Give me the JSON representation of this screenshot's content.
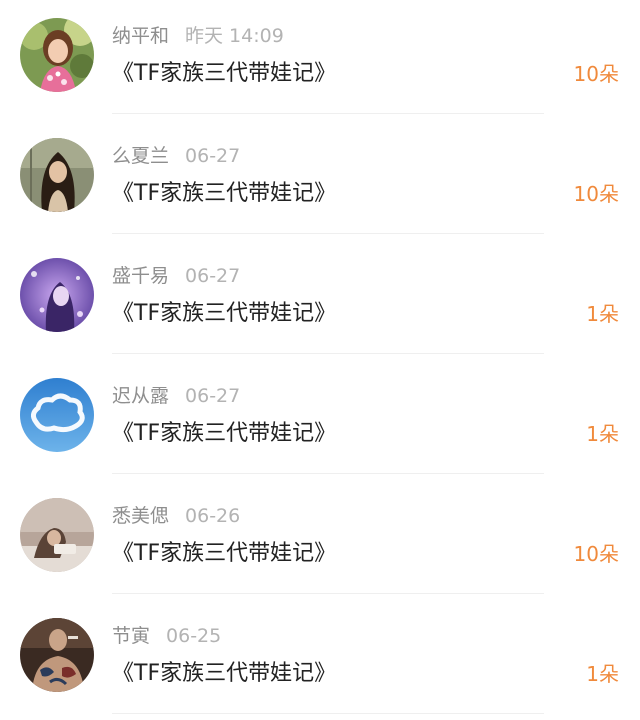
{
  "accent_color": "#f08a3c",
  "items": [
    {
      "name": "纳平和",
      "time": "昨天 14:09",
      "title": "《TF家族三代带娃记》",
      "count": "10朵",
      "avatar_icon": "woman-flowers-avatar"
    },
    {
      "name": "么夏兰",
      "time": "06-27",
      "title": "《TF家族三代带娃记》",
      "count": "10朵",
      "avatar_icon": "woman-long-hair-avatar"
    },
    {
      "name": "盛千易",
      "time": "06-27",
      "title": "《TF家族三代带娃记》",
      "count": "1朵",
      "avatar_icon": "purple-girl-avatar"
    },
    {
      "name": "迟从露",
      "time": "06-27",
      "title": "《TF家族三代带娃记》",
      "count": "1朵",
      "avatar_icon": "cloud-avatar"
    },
    {
      "name": "悉美偲",
      "time": "06-26",
      "title": "《TF家族三代带娃记》",
      "count": "10朵",
      "avatar_icon": "reading-woman-avatar"
    },
    {
      "name": "节寅",
      "time": "06-25",
      "title": "《TF家族三代带娃记》",
      "count": "1朵",
      "avatar_icon": "tattoo-man-avatar"
    }
  ]
}
